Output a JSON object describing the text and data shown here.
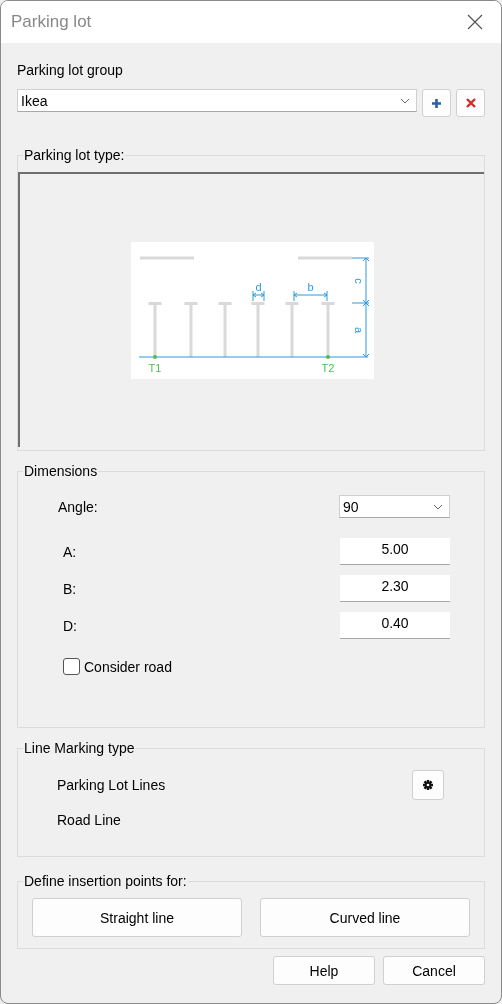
{
  "window": {
    "title": "Parking lot"
  },
  "group": {
    "label": "Parking lot group",
    "value": "Ikea"
  },
  "parking_lot_type": {
    "title": "Parking lot type:",
    "diagram_labels": {
      "d": "d",
      "b": "b",
      "c": "c",
      "a": "a",
      "start": "T1",
      "end": "T2"
    }
  },
  "dimensions": {
    "title": "Dimensions",
    "angle": {
      "label": "Angle:",
      "value": "90"
    },
    "fields": [
      {
        "label": "A:",
        "value": "5.00"
      },
      {
        "label": "B:",
        "value": "2.30"
      },
      {
        "label": "D:",
        "value": "0.40"
      }
    ],
    "consider_road": {
      "label": "Consider road",
      "checked": false
    }
  },
  "line_marking": {
    "title": "Line Marking type",
    "items": [
      {
        "label": "Parking Lot Lines",
        "has_settings": true
      },
      {
        "label": "Road Line",
        "has_settings": false
      }
    ]
  },
  "insertion": {
    "title": "Define insertion points for:",
    "buttons": [
      "Straight line",
      "Curved line"
    ]
  },
  "buttons": [
    "Help",
    "Cancel"
  ]
}
